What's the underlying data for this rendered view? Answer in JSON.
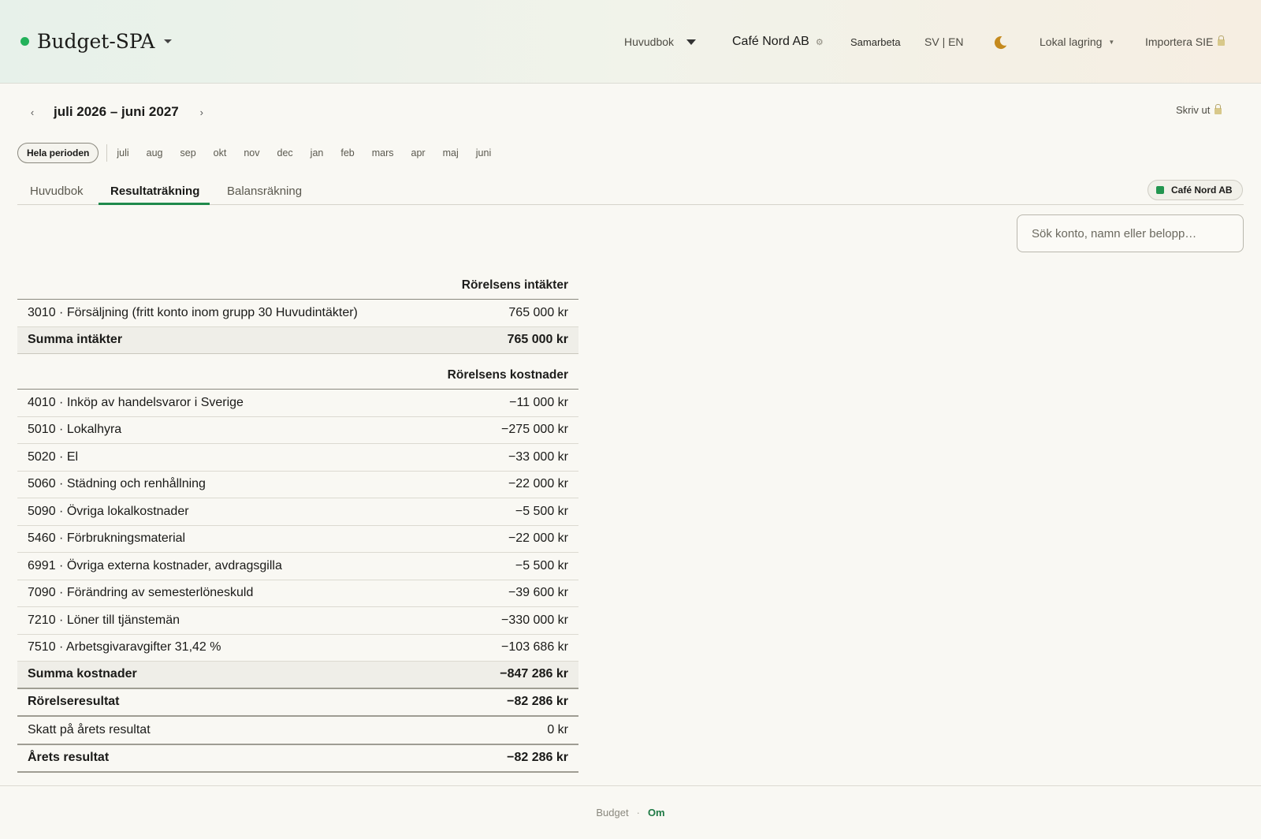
{
  "header": {
    "app_title": "Budget-SPA",
    "ledger": "Huvudbok",
    "company": "Café Nord AB",
    "collaborate": "Samarbeta",
    "language": "SV | EN",
    "storage": "Lokal lagring",
    "import": "Importera SIE",
    "accent_color": "#22b15a",
    "icons": [
      "chevron-down-icon",
      "gear-icon",
      "moon-icon",
      "lock-icon"
    ]
  },
  "period": {
    "label": "juli 2026 – juni 2027",
    "print": "Skriv ut"
  },
  "months": {
    "all": "Hela perioden",
    "items": [
      "juli",
      "aug",
      "sep",
      "okt",
      "nov",
      "dec",
      "jan",
      "feb",
      "mars",
      "apr",
      "maj",
      "juni"
    ]
  },
  "tabs": {
    "items": [
      "Huvudbok",
      "Resultaträkning",
      "Balansräkning"
    ],
    "active": "Resultaträkning",
    "company_badge": "Café Nord AB"
  },
  "search": {
    "placeholder": "Sök konto, namn eller belopp…"
  },
  "report": {
    "income_header": "Rörelsens intäkter",
    "income_rows": [
      {
        "label": "3010 · Försäljning (fritt konto inom grupp 30 Huvudintäkter)",
        "amount": "765 000 kr"
      }
    ],
    "income_total": {
      "label": "Summa intäkter",
      "amount": "765 000 kr"
    },
    "cost_header": "Rörelsens kostnader",
    "cost_rows": [
      {
        "label": "4010 · Inköp av handelsvaror i Sverige",
        "amount": "−11 000 kr"
      },
      {
        "label": "5010 · Lokalhyra",
        "amount": "−275 000 kr"
      },
      {
        "label": "5020 · El",
        "amount": "−33 000 kr"
      },
      {
        "label": "5060 · Städning och renhållning",
        "amount": "−22 000 kr"
      },
      {
        "label": "5090 · Övriga lokalkostnader",
        "amount": "−5 500 kr"
      },
      {
        "label": "5460 · Förbrukningsmaterial",
        "amount": "−22 000 kr"
      },
      {
        "label": "6991 · Övriga externa kostnader, avdragsgilla",
        "amount": "−5 500 kr"
      },
      {
        "label": "7090 · Förändring av semesterlöneskuld",
        "amount": "−39 600 kr"
      },
      {
        "label": "7210 · Löner till tjänstemän",
        "amount": "−330 000 kr"
      },
      {
        "label": "7510 · Arbetsgivaravgifter 31,42 %",
        "amount": "−103 686 kr"
      }
    ],
    "cost_total": {
      "label": "Summa kostnader",
      "amount": "−847 286 kr"
    },
    "operating_result": {
      "label": "Rörelseresultat",
      "amount": "−82 286 kr"
    },
    "tax": {
      "label": "Skatt på årets resultat",
      "amount": "0 kr"
    },
    "year_result": {
      "label": "Årets resultat",
      "amount": "−82 286 kr"
    }
  },
  "footer": {
    "budget": "Budget",
    "separator": "·",
    "about": "Om"
  }
}
